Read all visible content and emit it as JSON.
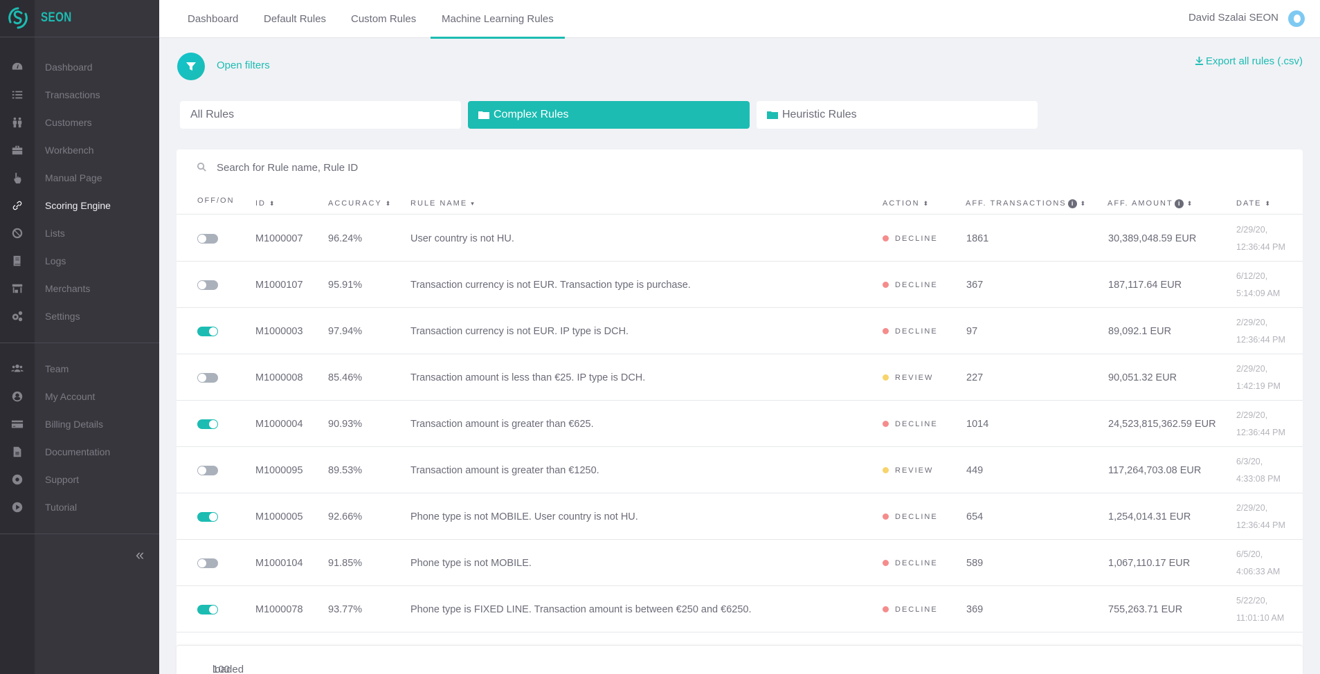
{
  "brand": {
    "name": "SEON"
  },
  "sidebar": {
    "primary": [
      {
        "label": "Dashboard",
        "icon": "dashboard-gauge-icon"
      },
      {
        "label": "Transactions",
        "icon": "list-icon"
      },
      {
        "label": "Customers",
        "icon": "customers-icon"
      },
      {
        "label": "Workbench",
        "icon": "toolbox-icon"
      },
      {
        "label": "Manual Page",
        "icon": "hand-pointer-icon"
      },
      {
        "label": "Scoring Engine",
        "icon": "link-icon",
        "active": true
      },
      {
        "label": "Lists",
        "icon": "ban-icon"
      },
      {
        "label": "Logs",
        "icon": "book-icon"
      },
      {
        "label": "Merchants",
        "icon": "store-icon"
      },
      {
        "label": "Settings",
        "icon": "gears-icon"
      }
    ],
    "secondary": [
      {
        "label": "Team",
        "icon": "team-icon"
      },
      {
        "label": "My Account",
        "icon": "user-circle-icon"
      },
      {
        "label": "Billing Details",
        "icon": "credit-card-icon"
      },
      {
        "label": "Documentation",
        "icon": "document-icon"
      },
      {
        "label": "Support",
        "icon": "life-ring-icon"
      },
      {
        "label": "Tutorial",
        "icon": "play-circle-icon"
      }
    ],
    "collapse_label": "«"
  },
  "topbar": {
    "tabs": [
      {
        "label": "Dashboard"
      },
      {
        "label": "Default Rules"
      },
      {
        "label": "Custom Rules"
      },
      {
        "label": "Machine Learning Rules",
        "active": true
      }
    ],
    "user_name": "David Szalai SEON"
  },
  "toolbar": {
    "open_filters": "Open filters",
    "export": "Export all rules (.csv)"
  },
  "categories": [
    {
      "label": "All Rules"
    },
    {
      "label": "Complex Rules",
      "active": true
    },
    {
      "label": "Heuristic Rules"
    }
  ],
  "search": {
    "placeholder": "Search for Rule name, Rule ID"
  },
  "table": {
    "columns": {
      "toggle": "OFF/ON",
      "id": "ID",
      "accuracy": "ACCURACY",
      "rule_name": "RULE NAME",
      "action": "ACTION",
      "aff_transactions": "AFF. TRANSACTIONS",
      "aff_amount": "AFF. AMOUNT",
      "date": "DATE"
    },
    "colors": {
      "decline": "#f58c8c",
      "review": "#f7d46c",
      "accent": "#1cbcb2"
    },
    "rows": [
      {
        "on": false,
        "id": "M1000007",
        "accuracy": "96.24%",
        "name": "User country is not HU.",
        "action": "DECLINE",
        "tx": "1861",
        "amount": "30,389,048.59 EUR",
        "date": "2/29/20,",
        "time": "12:36:44 PM"
      },
      {
        "on": false,
        "id": "M1000107",
        "accuracy": "95.91%",
        "name": "Transaction currency is not EUR. Transaction type is purchase.",
        "action": "DECLINE",
        "tx": "367",
        "amount": "187,117.64 EUR",
        "date": "6/12/20,",
        "time": "5:14:09 AM"
      },
      {
        "on": true,
        "id": "M1000003",
        "accuracy": "97.94%",
        "name": "Transaction currency is not EUR. IP type is DCH.",
        "action": "DECLINE",
        "tx": "97",
        "amount": "89,092.1 EUR",
        "date": "2/29/20,",
        "time": "12:36:44 PM"
      },
      {
        "on": false,
        "id": "M1000008",
        "accuracy": "85.46%",
        "name": "Transaction amount is less than €25. IP type is DCH.",
        "action": "REVIEW",
        "tx": "227",
        "amount": "90,051.32 EUR",
        "date": "2/29/20,",
        "time": "1:42:19 PM"
      },
      {
        "on": true,
        "id": "M1000004",
        "accuracy": "90.93%",
        "name": "Transaction amount is greater than €625.",
        "action": "DECLINE",
        "tx": "1014",
        "amount": "24,523,815,362.59 EUR",
        "date": "2/29/20,",
        "time": "12:36:44 PM"
      },
      {
        "on": false,
        "id": "M1000095",
        "accuracy": "89.53%",
        "name": "Transaction amount is greater than €1250.",
        "action": "REVIEW",
        "tx": "449",
        "amount": "117,264,703.08 EUR",
        "date": "6/3/20,",
        "time": "4:33:08 PM"
      },
      {
        "on": true,
        "id": "M1000005",
        "accuracy": "92.66%",
        "name": "Phone type is not MOBILE. User country is not HU.",
        "action": "DECLINE",
        "tx": "654",
        "amount": "1,254,014.31 EUR",
        "date": "2/29/20,",
        "time": "12:36:44 PM"
      },
      {
        "on": false,
        "id": "M1000104",
        "accuracy": "91.85%",
        "name": "Phone type is not MOBILE.",
        "action": "DECLINE",
        "tx": "589",
        "amount": "1,067,110.17 EUR",
        "date": "6/5/20,",
        "time": "4:06:33 AM"
      },
      {
        "on": true,
        "id": "M1000078",
        "accuracy": "93.77%",
        "name": "Phone type is FIXED LINE. Transaction amount is between €250 and €6250.",
        "action": "DECLINE",
        "tx": "369",
        "amount": "755,263.71 EUR",
        "date": "5/22/20,",
        "time": "11:01:10 AM"
      }
    ]
  },
  "footer": {
    "loaded_count": "100",
    "loaded_label": "loaded"
  }
}
